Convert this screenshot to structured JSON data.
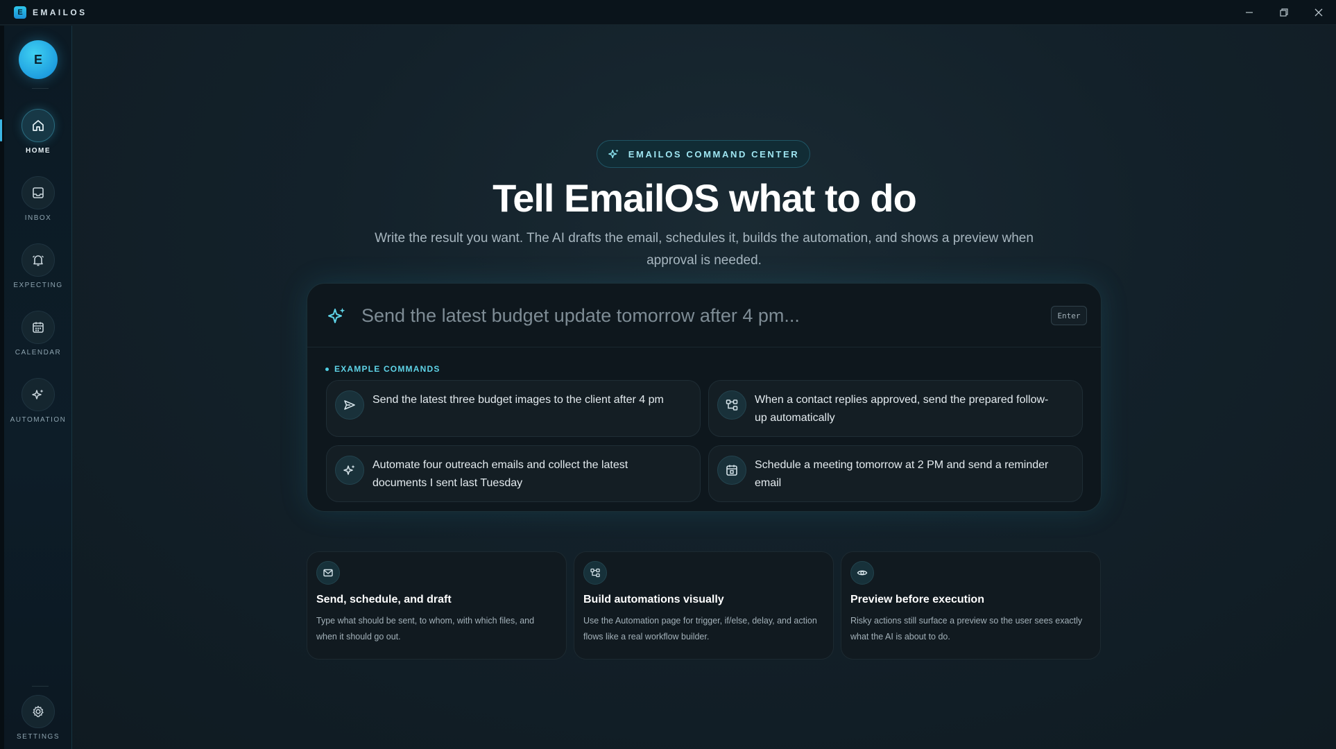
{
  "window": {
    "app_logo_letter": "E",
    "app_name": "EMAILOS"
  },
  "sidebar": {
    "avatar_letter": "E",
    "items": [
      {
        "label": "HOME",
        "icon": "home-icon",
        "active": true
      },
      {
        "label": "INBOX",
        "icon": "inbox-icon",
        "active": false
      },
      {
        "label": "EXPECTING",
        "icon": "bell-icon",
        "active": false
      },
      {
        "label": "CALENDAR",
        "icon": "calendar-icon",
        "active": false
      },
      {
        "label": "AUTOMATION",
        "icon": "sparkle-icon",
        "active": false
      }
    ],
    "settings_label": "SETTINGS"
  },
  "hero": {
    "badge": "EMAILOS COMMAND CENTER",
    "title": "Tell EmailOS what to do",
    "subtitle": "Write the result you want. The AI drafts the email, schedules it, builds the automation, and shows a preview when approval is needed."
  },
  "command": {
    "placeholder": "Send the latest budget update tomorrow after 4 pm...",
    "value": "",
    "enter_hint": "Enter",
    "examples_heading": "EXAMPLE COMMANDS",
    "examples": [
      {
        "icon": "send-icon",
        "text": "Send the latest three budget images to the client after 4 pm"
      },
      {
        "icon": "workflow-icon",
        "text": "When a contact replies approved, send the prepared follow-up automatically"
      },
      {
        "icon": "sparkle-icon",
        "text": "Automate four outreach emails and collect the latest documents I sent last Tuesday"
      },
      {
        "icon": "calendar-icon",
        "text": "Schedule a meeting tomorrow at 2 PM and send a reminder email"
      }
    ]
  },
  "features": [
    {
      "icon": "mail-icon",
      "title": "Send, schedule, and draft",
      "description": "Type what should be sent, to whom, with which files, and when it should go out."
    },
    {
      "icon": "workflow-icon",
      "title": "Build automations visually",
      "description": "Use the Automation page for trigger, if/else, delay, and action flows like a real workflow builder."
    },
    {
      "icon": "eye-icon",
      "title": "Preview before execution",
      "description": "Risky actions still surface a preview so the user sees exactly what the AI is about to do."
    }
  ],
  "colors": {
    "accent": "#3cb7e6",
    "accent_text": "#5fd4e8",
    "background": "#13212a",
    "panel": "#0e171d"
  }
}
